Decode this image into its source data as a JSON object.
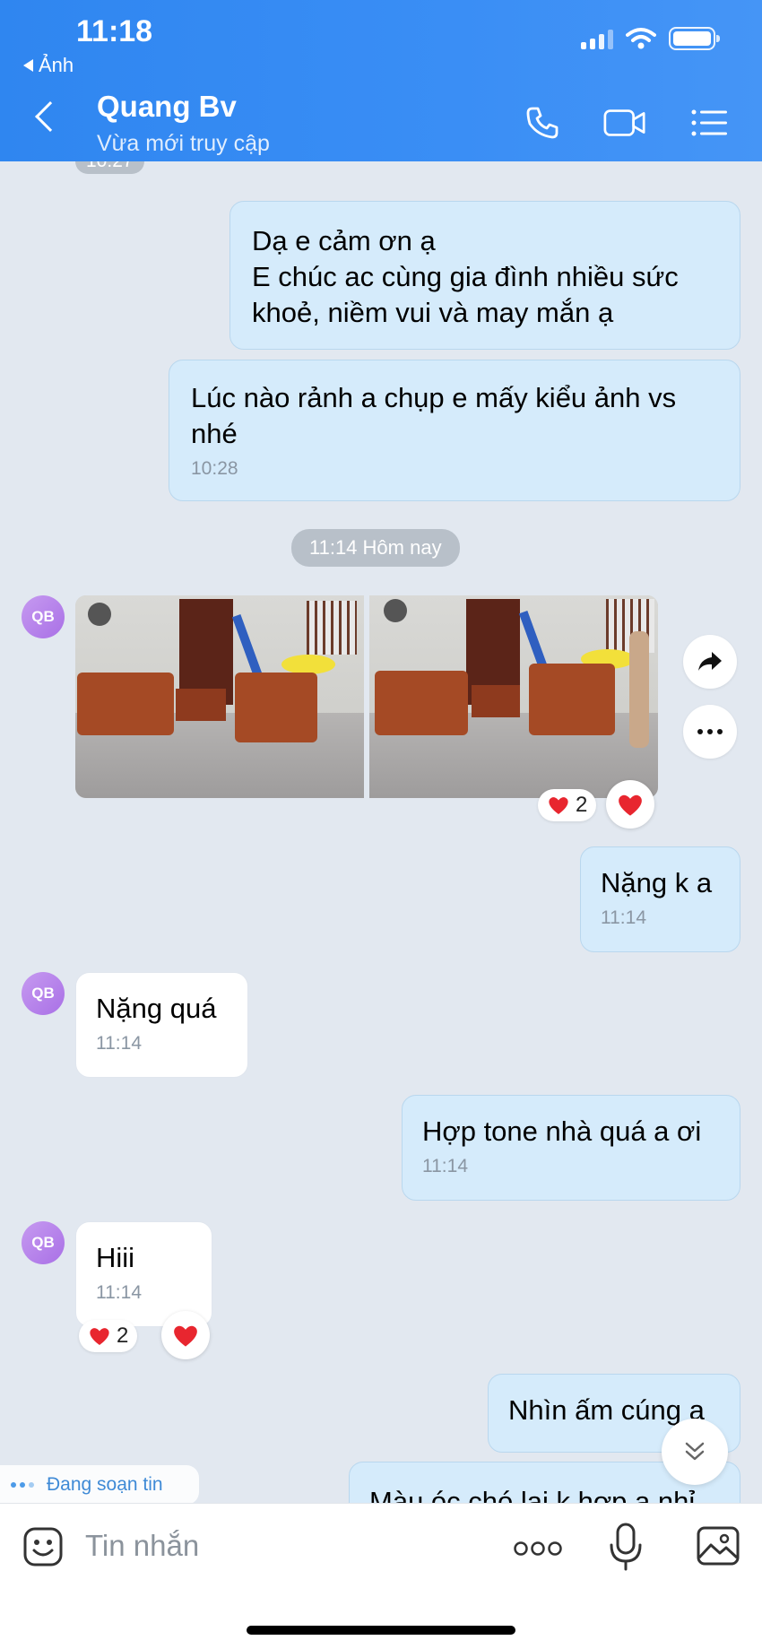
{
  "status_bar": {
    "time": "11:18",
    "back_app": "Ảnh"
  },
  "header": {
    "name": "Quang Bv",
    "status": "Vừa mới truy cập"
  },
  "messages": {
    "prev_time": "10:27",
    "m1": {
      "lines": [
        "Dạ e cảm ơn ạ",
        "E chúc ac cùng gia đình nhiều sức",
        "khoẻ, niềm vui và may mắn ạ"
      ]
    },
    "m2": {
      "lines": [
        "Lúc nào rảnh a chụp e mấy kiểu ảnh vs",
        "nhé"
      ],
      "time": "10:28"
    },
    "day_divider": "11:14 Hôm nay",
    "avatar_initials": "QB",
    "photos_reaction_count": "2",
    "m3": {
      "text": "Nặng k a",
      "time": "11:14"
    },
    "m4": {
      "text": "Nặng quá",
      "time": "11:14"
    },
    "m5": {
      "text": "Hợp tone nhà quá a ơi",
      "time": "11:14"
    },
    "m6": {
      "text": "Hiii",
      "time": "11:14",
      "reaction_count": "2"
    },
    "m7": {
      "text": "Nhìn ấm cúng a"
    },
    "m8": {
      "text": "Màu óc chó lại k hợp a nhỉ"
    }
  },
  "typing_indicator": "Đang soạn tin",
  "composer": {
    "placeholder": "Tin nhắn"
  },
  "colors": {
    "header": "#3a8ef5",
    "outgoing_bubble": "#d5ebfb",
    "incoming_bubble": "#ffffff",
    "background": "#e2e8f0",
    "heart": "#e8262f"
  }
}
